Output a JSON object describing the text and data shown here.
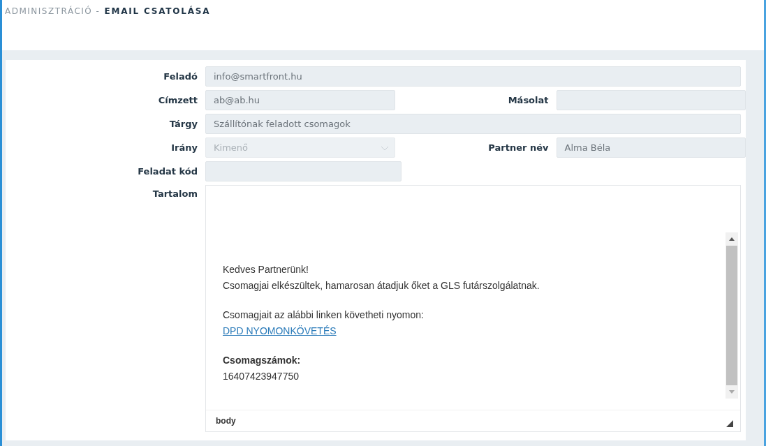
{
  "breadcrumb": {
    "parent": "ADMINISZTRÁCIÓ -",
    "current": "EMAIL CSATOLÁSA"
  },
  "rows": [
    {
      "kind": "wide",
      "fields": [
        {
          "label": "Feladó",
          "kind": "text",
          "value": "info@smartfront.hu",
          "disabled": false
        }
      ]
    },
    {
      "kind": "split",
      "fields": [
        {
          "label": "Címzett",
          "kind": "text",
          "value": "ab@ab.hu",
          "disabled": false
        },
        {
          "label": "Másolat",
          "kind": "text"
        }
      ]
    },
    {
      "kind": "wide",
      "fields": [
        {
          "label": "Tárgy",
          "kind": "text",
          "value": "Szállítónak feladott csomagok",
          "disabled": false
        }
      ]
    },
    {
      "kind": "split",
      "fields": [
        {
          "label": "Irány",
          "kind": "select",
          "value": "Kimenő",
          "disabled": true
        },
        {
          "label": "Partner név",
          "kind": "text",
          "value": "Alma Béla",
          "disabled": false
        }
      ]
    },
    {
      "kind": "split",
      "fields": [
        {
          "label": "Feladat kód",
          "kind": "text"
        }
      ]
    }
  ],
  "content": {
    "label": "Tartalom",
    "status_path": "body",
    "paragraphs": [
      [
        {
          "kind": "text",
          "text": "Kedves Partnerünk!"
        },
        {
          "kind": "text",
          "text": "Csomagjai elkészültek, hamarosan átadjuk őket a GLS futárszolgálatnak."
        }
      ],
      [
        {
          "kind": "text",
          "text": "Csomagjait az alábbi linken követheti nyomon:"
        },
        {
          "kind": "link",
          "text": "DPD NYOMONKÖVETÉS"
        }
      ],
      [
        {
          "kind": "heading",
          "text": "Csomagszámok:"
        },
        {
          "kind": "text",
          "text": "16407423947750"
        }
      ]
    ]
  }
}
